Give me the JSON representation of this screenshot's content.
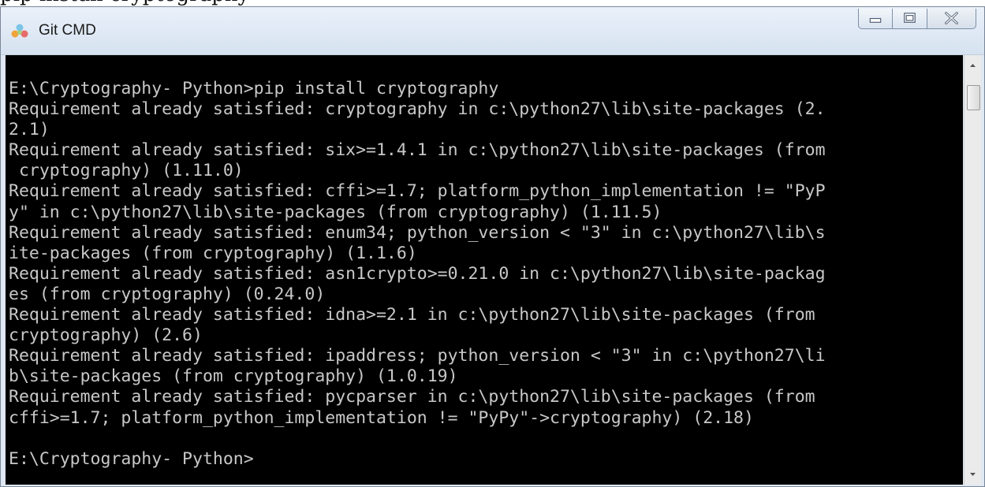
{
  "page_header_fragment": "pip install cryptography",
  "window": {
    "title": "Git CMD",
    "app_icon": "git-cmd-icon",
    "controls": {
      "minimize_icon": "minimize-icon",
      "maximize_icon": "maximize-icon",
      "close_icon": "close-icon"
    }
  },
  "console": {
    "background": "#000000",
    "text_color": "#c8c8c8",
    "lines": [
      "E:\\Cryptography- Python>pip install cryptography",
      "Requirement already satisfied: cryptography in c:\\python27\\lib\\site-packages (2.",
      "2.1)",
      "Requirement already satisfied: six>=1.4.1 in c:\\python27\\lib\\site-packages (from",
      " cryptography) (1.11.0)",
      "Requirement already satisfied: cffi>=1.7; platform_python_implementation != \"PyP",
      "y\" in c:\\python27\\lib\\site-packages (from cryptography) (1.11.5)",
      "Requirement already satisfied: enum34; python_version < \"3\" in c:\\python27\\lib\\s",
      "ite-packages (from cryptography) (1.1.6)",
      "Requirement already satisfied: asn1crypto>=0.21.0 in c:\\python27\\lib\\site-packag",
      "es (from cryptography) (0.24.0)",
      "Requirement already satisfied: idna>=2.1 in c:\\python27\\lib\\site-packages (from",
      "cryptography) (2.6)",
      "Requirement already satisfied: ipaddress; python_version < \"3\" in c:\\python27\\li",
      "b\\site-packages (from cryptography) (1.0.19)",
      "Requirement already satisfied: pycparser in c:\\python27\\lib\\site-packages (from",
      "cffi>=1.7; platform_python_implementation != \"PyPy\"->cryptography) (2.18)",
      "",
      "E:\\Cryptography- Python>"
    ]
  },
  "scrollbar": {
    "up_icon": "scroll-up-arrow-icon",
    "down_icon": "scroll-down-arrow-icon"
  }
}
